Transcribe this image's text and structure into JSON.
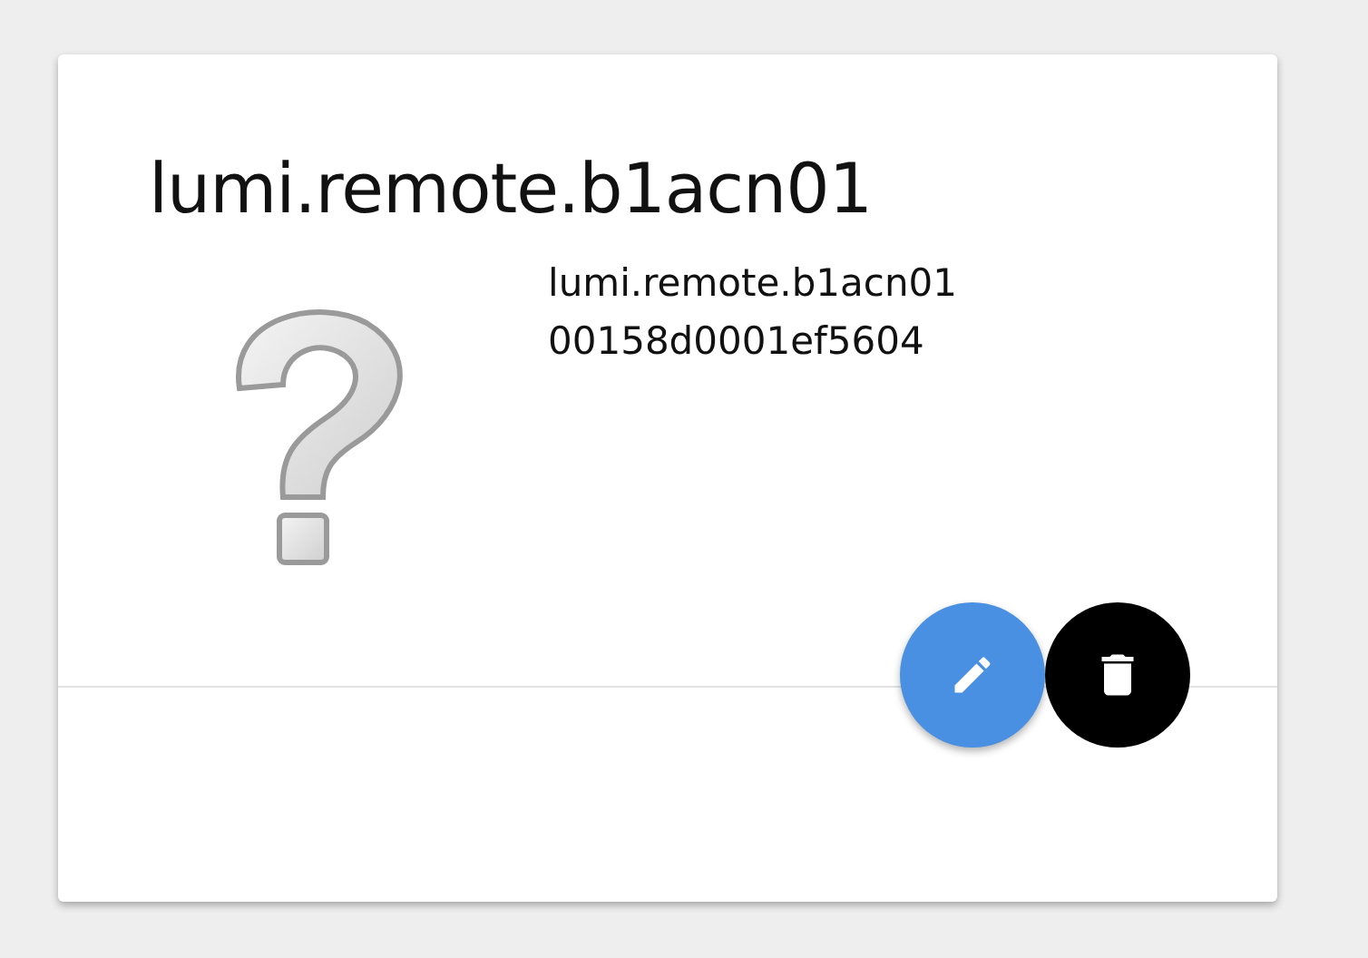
{
  "card": {
    "title": "lumi.remote.b1acn01",
    "details": [
      "lumi.remote.b1acn01",
      "00158d0001ef5604"
    ]
  }
}
